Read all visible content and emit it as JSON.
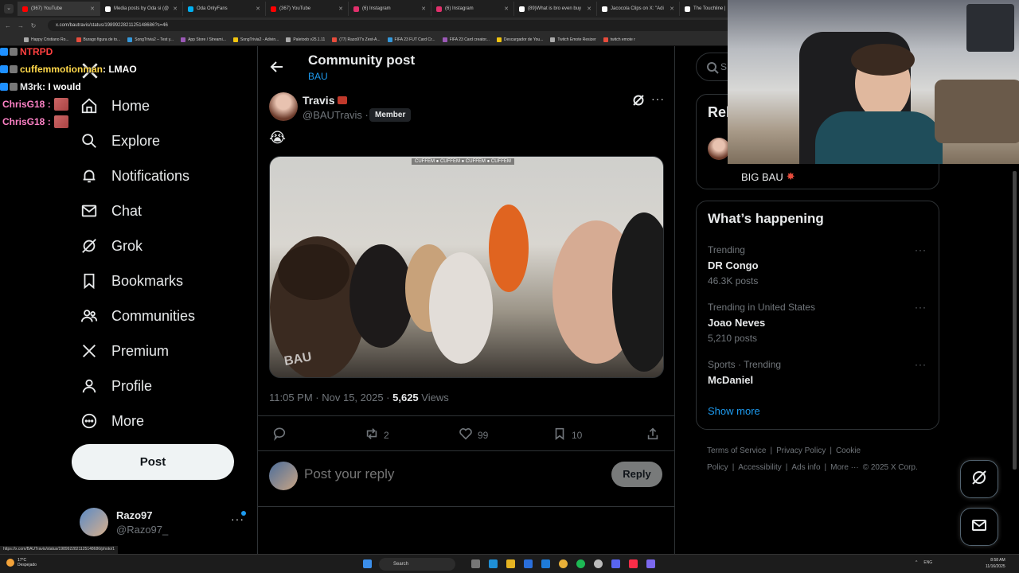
{
  "browser": {
    "tabs": [
      {
        "title": "(367) YouTube",
        "color": "#ff0000"
      },
      {
        "title": "Media posts by Oda si (@",
        "color": "#ffffff"
      },
      {
        "title": "Oda OnlyFans",
        "color": "#00aff0"
      },
      {
        "title": "(367) YouTube",
        "color": "#ff0000"
      },
      {
        "title": "(6) Instagram",
        "color": "#e1306c"
      },
      {
        "title": "(6) Instagram",
        "color": "#e1306c"
      },
      {
        "title": "(89)What is bro even buy",
        "color": "#ffffff"
      },
      {
        "title": "Jacocola Clips on X: \"Adi",
        "color": "#ffffff"
      },
      {
        "title": "The Touchline |",
        "color": "#ffffff"
      }
    ],
    "url": "x.com/bautravis/status/1989922821125148686?s=46",
    "bookmarks": [
      "Happy Cristiano Ro...",
      "Burago figura de to...",
      "SongTrivia2 – Test y...",
      "App Store / Streami...",
      "SongTrivia2 - Adivin...",
      "Paletoob v25.1.11",
      "(77) Razo97's Zest-A...",
      "FIFA 23 FUT Card Cr...",
      "FIFA 23 Card creator...",
      "Descargador de You...",
      "Twitch Emote Resizer",
      "twitch emote r"
    ],
    "status_url": "https://x.com/BAUTravis/status/1989922821125148686/photo/1"
  },
  "chat": [
    {
      "user": "NTRPD",
      "message": "",
      "color": "#ff4040"
    },
    {
      "user": "cuffemmotionman",
      "message": " : LMAO",
      "color": "#ffd84a"
    },
    {
      "user": "M3rk",
      "message": " : I would",
      "color": "#e7e9ea"
    },
    {
      "user": "ChrisG18 :",
      "message": "",
      "color": "#ff82c7"
    },
    {
      "user": "ChrisG18 :",
      "message": "",
      "color": "#ff82c7"
    }
  ],
  "sidebar": {
    "items": [
      {
        "label": "Home",
        "icon": "home-icon"
      },
      {
        "label": "Explore",
        "icon": "search-icon"
      },
      {
        "label": "Notifications",
        "icon": "bell-icon"
      },
      {
        "label": "Chat",
        "icon": "mail-icon"
      },
      {
        "label": "Grok",
        "icon": "grok-icon"
      },
      {
        "label": "Bookmarks",
        "icon": "bookmark-icon"
      },
      {
        "label": "Communities",
        "icon": "people-icon"
      },
      {
        "label": "Premium",
        "icon": "x-icon"
      },
      {
        "label": "Profile",
        "icon": "person-icon"
      },
      {
        "label": "More",
        "icon": "more-circle-icon"
      }
    ],
    "post_button": "Post",
    "account": {
      "name": "Razo97",
      "handle": "@Razo97_"
    }
  },
  "main": {
    "title": "Community post",
    "subtitle": "BAU",
    "post": {
      "author_name": "Travis",
      "author_handle": "@BAUTravis ·",
      "badge": "Member",
      "text": "😭",
      "media_banner": "CUFFEM ● CUFFEM ● CUFFEM ● CUFFEM",
      "media_watermark": "BAU",
      "time": "11:05 PM · Nov 15, 2025 · ",
      "views_count": "5,625",
      "views_label": " Views",
      "actions": {
        "replies": "",
        "reposts": "2",
        "likes": "99",
        "bookmarks": "10"
      }
    },
    "reply": {
      "placeholder": "Post your reply",
      "button": "Reply"
    }
  },
  "right": {
    "search_placeholder": "S",
    "relevant_title": "Rel",
    "relevant_bio": "BIG BAU",
    "happening_title": "What’s happening",
    "trends": [
      {
        "context": "Trending",
        "name": "DR Congo",
        "count": "46.3K posts"
      },
      {
        "context": "Trending in United States",
        "name": "Joao Neves",
        "count": "5,210 posts"
      },
      {
        "context": "Sports · Trending",
        "name": "McDaniel",
        "count": ""
      }
    ],
    "show_more": "Show more",
    "footer_links": [
      "Terms of Service",
      "|",
      "Privacy Policy",
      "|",
      "Cookie Policy",
      "|",
      "Accessibility",
      "|",
      "Ads info",
      "|",
      "More ···",
      "© 2025 X Corp."
    ]
  },
  "taskbar": {
    "weather_temp": "17°C",
    "weather_desc": "Despejado",
    "search_label": "Search",
    "lang": "ENG",
    "time": "8:58 AM",
    "date": "11/16/2025"
  }
}
